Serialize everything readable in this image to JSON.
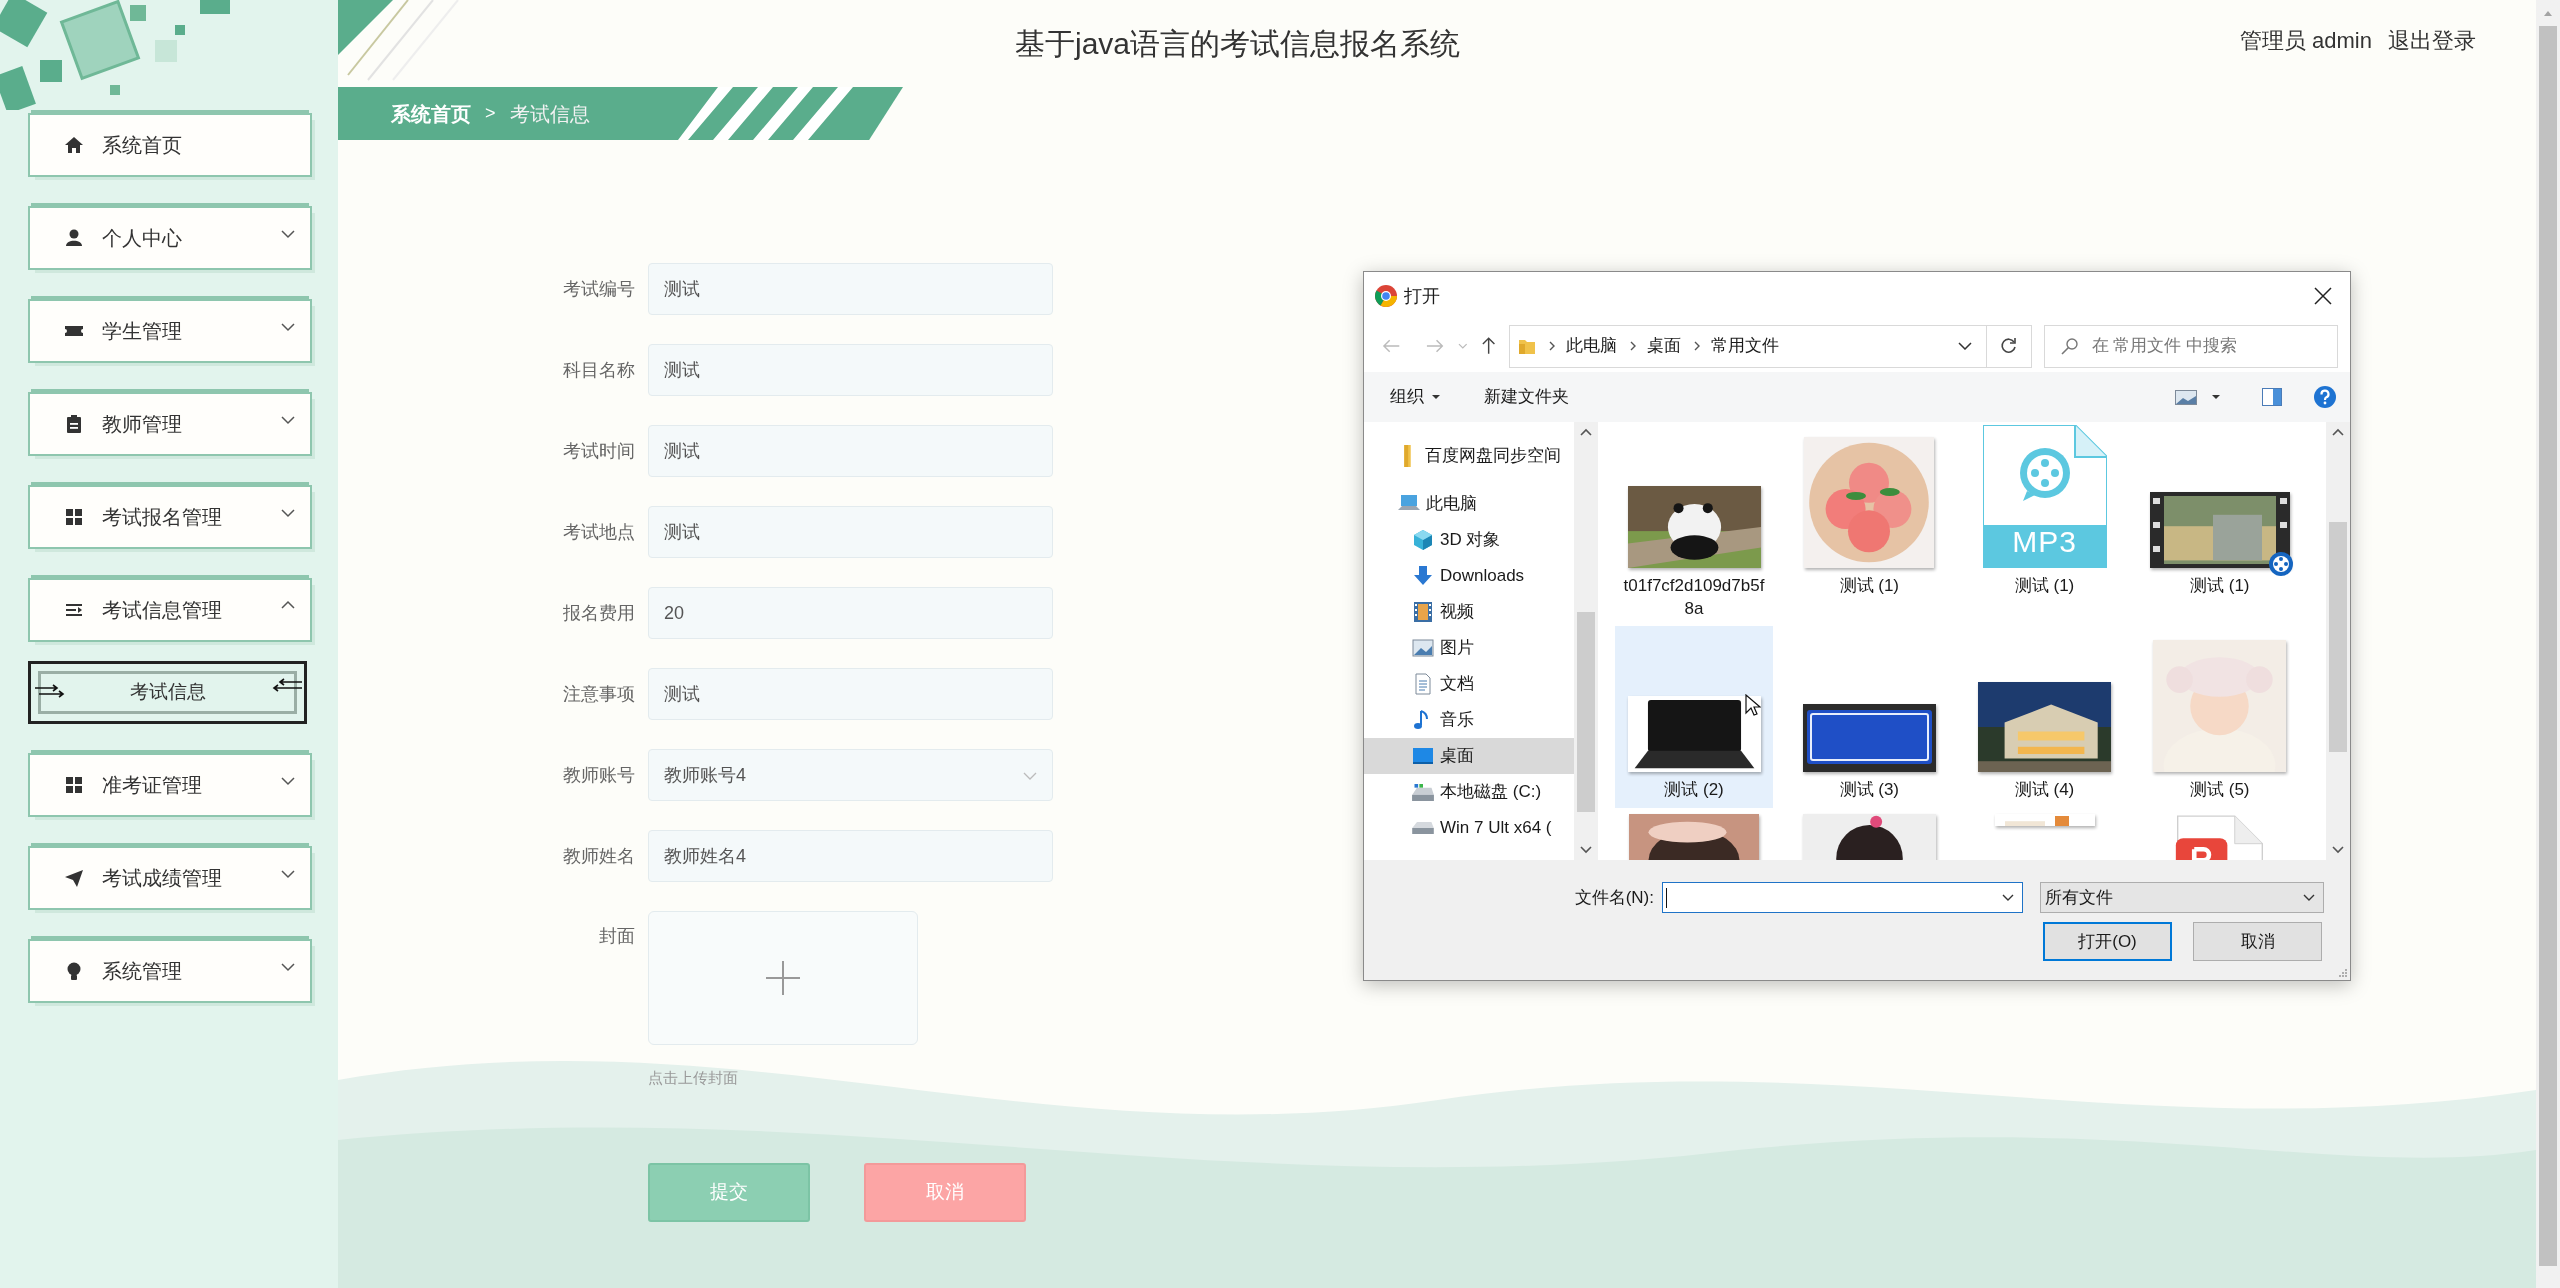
{
  "header": {
    "title": "基于java语言的考试信息报名系统",
    "user": "管理员 admin",
    "logout": "退出登录"
  },
  "breadcrumb": {
    "separator": ">",
    "items": [
      {
        "label": "系统首页",
        "current": false
      },
      {
        "label": "考试信息",
        "current": true
      }
    ]
  },
  "sidebar": {
    "items": [
      {
        "label": "系统首页",
        "kind": "link"
      },
      {
        "label": "个人中心",
        "kind": "menu",
        "expanded": false
      },
      {
        "label": "学生管理",
        "kind": "menu",
        "expanded": false
      },
      {
        "label": "教师管理",
        "kind": "menu",
        "expanded": false
      },
      {
        "label": "考试报名管理",
        "kind": "menu",
        "expanded": false
      },
      {
        "label": "考试信息管理",
        "kind": "menu",
        "expanded": true,
        "children": [
          {
            "label": "考试信息",
            "selected": true
          }
        ]
      },
      {
        "label": "准考证管理",
        "kind": "menu",
        "expanded": false
      },
      {
        "label": "考试成绩管理",
        "kind": "menu",
        "expanded": false
      },
      {
        "label": "系统管理",
        "kind": "menu",
        "expanded": false
      }
    ]
  },
  "form": {
    "fields": [
      {
        "label": "考试编号",
        "value": "测试",
        "kind": "text"
      },
      {
        "label": "科目名称",
        "value": "测试",
        "kind": "text"
      },
      {
        "label": "考试时间",
        "value": "测试",
        "kind": "text"
      },
      {
        "label": "考试地点",
        "value": "测试",
        "kind": "text"
      },
      {
        "label": "报名费用",
        "value": "20",
        "kind": "text"
      },
      {
        "label": "注意事项",
        "value": "测试",
        "kind": "text"
      },
      {
        "label": "教师账号",
        "value": "教师账号4",
        "kind": "select"
      },
      {
        "label": "教师姓名",
        "value": "教师姓名4",
        "kind": "text"
      }
    ],
    "upload": {
      "label": "封面",
      "hint": "点击上传封面"
    },
    "buttons": [
      {
        "label": "提交",
        "kind": "primary"
      },
      {
        "label": "取消",
        "kind": "cancel"
      }
    ]
  },
  "dialog": {
    "title": "打开",
    "path": [
      "此电脑",
      "桌面",
      "常用文件"
    ],
    "search": {
      "placeholder": "在 常用文件 中搜索"
    },
    "toolbar": [
      "组织",
      "新建文件夹"
    ],
    "nav": [
      {
        "label": "百度网盘同步空间",
        "selected": false
      },
      {
        "label": "此电脑",
        "selected": false,
        "children": [
          {
            "label": "3D 对象",
            "selected": false
          },
          {
            "label": "Downloads",
            "selected": false
          },
          {
            "label": "视频",
            "selected": false
          },
          {
            "label": "图片",
            "selected": false
          },
          {
            "label": "文档",
            "selected": false
          },
          {
            "label": "音乐",
            "selected": false
          },
          {
            "label": "桌面",
            "selected": true
          },
          {
            "label": "本地磁盘 (C:)",
            "selected": false
          },
          {
            "label": "Win 7 Ult x64 (",
            "selected": false
          }
        ]
      }
    ],
    "files": [
      {
        "name": "t01f7cf2d109d7b5f8a",
        "kind": "picture",
        "selected": false
      },
      {
        "name": "测试 (1)",
        "kind": "picture",
        "selected": false
      },
      {
        "name": "测试 (1)",
        "kind": "audio",
        "type_label": "MP3",
        "selected": false
      },
      {
        "name": "测试 (1)",
        "kind": "video",
        "selected": false
      },
      {
        "name": "测试 (2)",
        "kind": "picture",
        "selected": true
      },
      {
        "name": "测试 (3)",
        "kind": "picture",
        "selected": false
      },
      {
        "name": "测试 (4)",
        "kind": "picture",
        "selected": false
      },
      {
        "name": "测试 (5)",
        "kind": "picture",
        "selected": false
      },
      {
        "kind": "picture",
        "selected": false
      },
      {
        "kind": "picture",
        "selected": false
      },
      {
        "kind": "picture",
        "selected": false
      },
      {
        "kind": "document",
        "selected": false
      }
    ],
    "filename": {
      "label": "文件名(N):"
    },
    "filter": "所有文件",
    "buttons": [
      {
        "label": "打开(O)",
        "kind": "default"
      },
      {
        "label": "取消",
        "kind": "normal"
      }
    ]
  }
}
